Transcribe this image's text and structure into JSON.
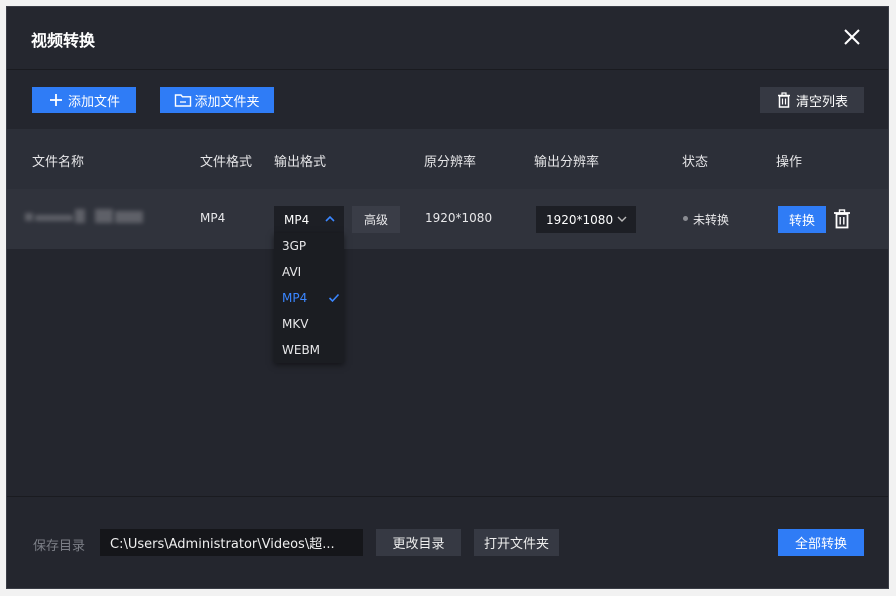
{
  "window": {
    "title": "视频转换"
  },
  "toolbar": {
    "add_file_label": "添加文件",
    "add_folder_label": "添加文件夹",
    "clear_list_label": "清空列表"
  },
  "table": {
    "columns": [
      "文件名称",
      "文件格式",
      "输出格式",
      "原分辨率",
      "输出分辨率",
      "状态",
      "操作"
    ],
    "rows": [
      {
        "file_format": "MP4",
        "output_format": "MP4",
        "advanced_label": "高级",
        "original_resolution": "1920*1080",
        "output_resolution": "1920*1080",
        "status": "未转换",
        "convert_label": "转换"
      }
    ]
  },
  "format_dropdown": {
    "options": [
      "3GP",
      "AVI",
      "MP4",
      "MKV",
      "WEBM"
    ],
    "selected": "MP4"
  },
  "footer": {
    "save_dir_label": "保存目录",
    "save_path": "C:\\Users\\Administrator\\Videos\\超...",
    "change_dir_label": "更改目录",
    "open_folder_label": "打开文件夹",
    "convert_all_label": "全部转换"
  },
  "colors": {
    "accent": "#2f7cf6",
    "background": "#24262e",
    "selected_option": "#3a86ff"
  }
}
